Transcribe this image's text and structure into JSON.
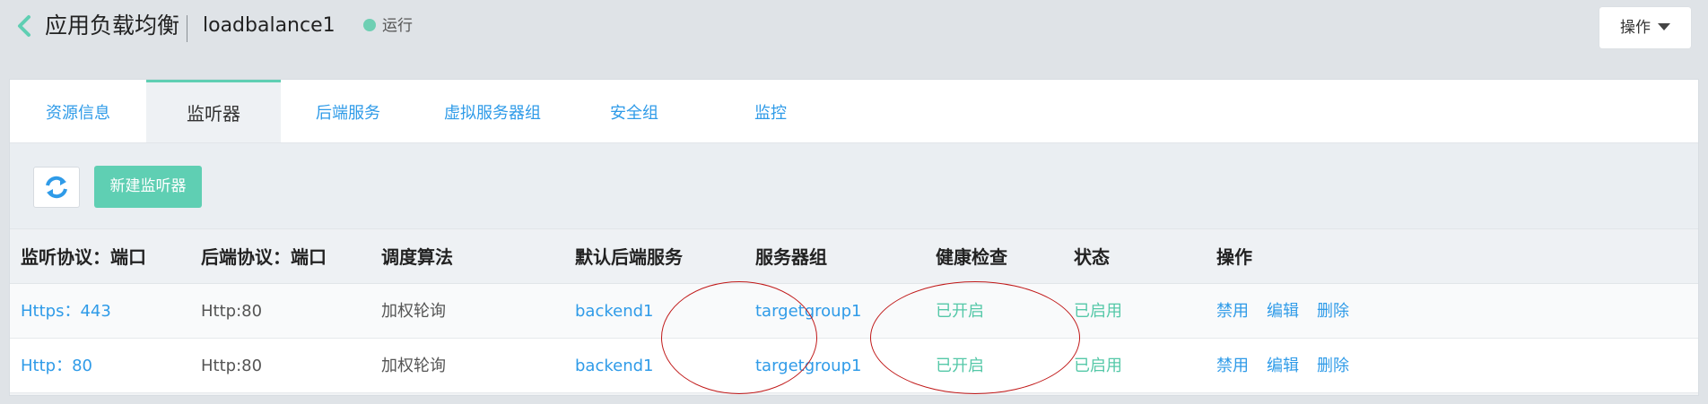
{
  "header": {
    "title": "应用负载均衡",
    "instance_name": "loadbalance1",
    "status": "运行",
    "actions_label": "操作"
  },
  "tabs": [
    {
      "label": "资源信息"
    },
    {
      "label": "监听器"
    },
    {
      "label": "后端服务"
    },
    {
      "label": "虚拟服务器组"
    },
    {
      "label": "安全组"
    },
    {
      "label": "监控"
    }
  ],
  "toolbar": {
    "new_listener_label": "新建监听器"
  },
  "table": {
    "columns": [
      "监听协议：端口",
      "后端协议：端口",
      "调度算法",
      "默认后端服务",
      "服务器组",
      "健康检查",
      "状态",
      "操作"
    ],
    "rows": [
      {
        "listener": "Https：443",
        "backend_protocol": "Http:80",
        "algorithm": "加权轮询",
        "default_backend": "backend1",
        "server_group": "targetgroup1",
        "health_check": "已开启",
        "status": "已启用",
        "actions": [
          "禁用",
          "编辑",
          "删除"
        ]
      },
      {
        "listener": "Http：80",
        "backend_protocol": "Http:80",
        "algorithm": "加权轮询",
        "default_backend": "backend1",
        "server_group": "targetgroup1",
        "health_check": "已开启",
        "status": "已启用",
        "actions": [
          "禁用",
          "编辑",
          "删除"
        ]
      }
    ]
  },
  "colors": {
    "accent_green": "#5fcfb3",
    "link_blue": "#2f9be8",
    "annotation_red": "#c01818"
  },
  "icons": {
    "back": "chevron-left-icon",
    "refresh": "refresh-icon",
    "status": "status-dot-icon",
    "dropdown": "caret-down-icon"
  }
}
